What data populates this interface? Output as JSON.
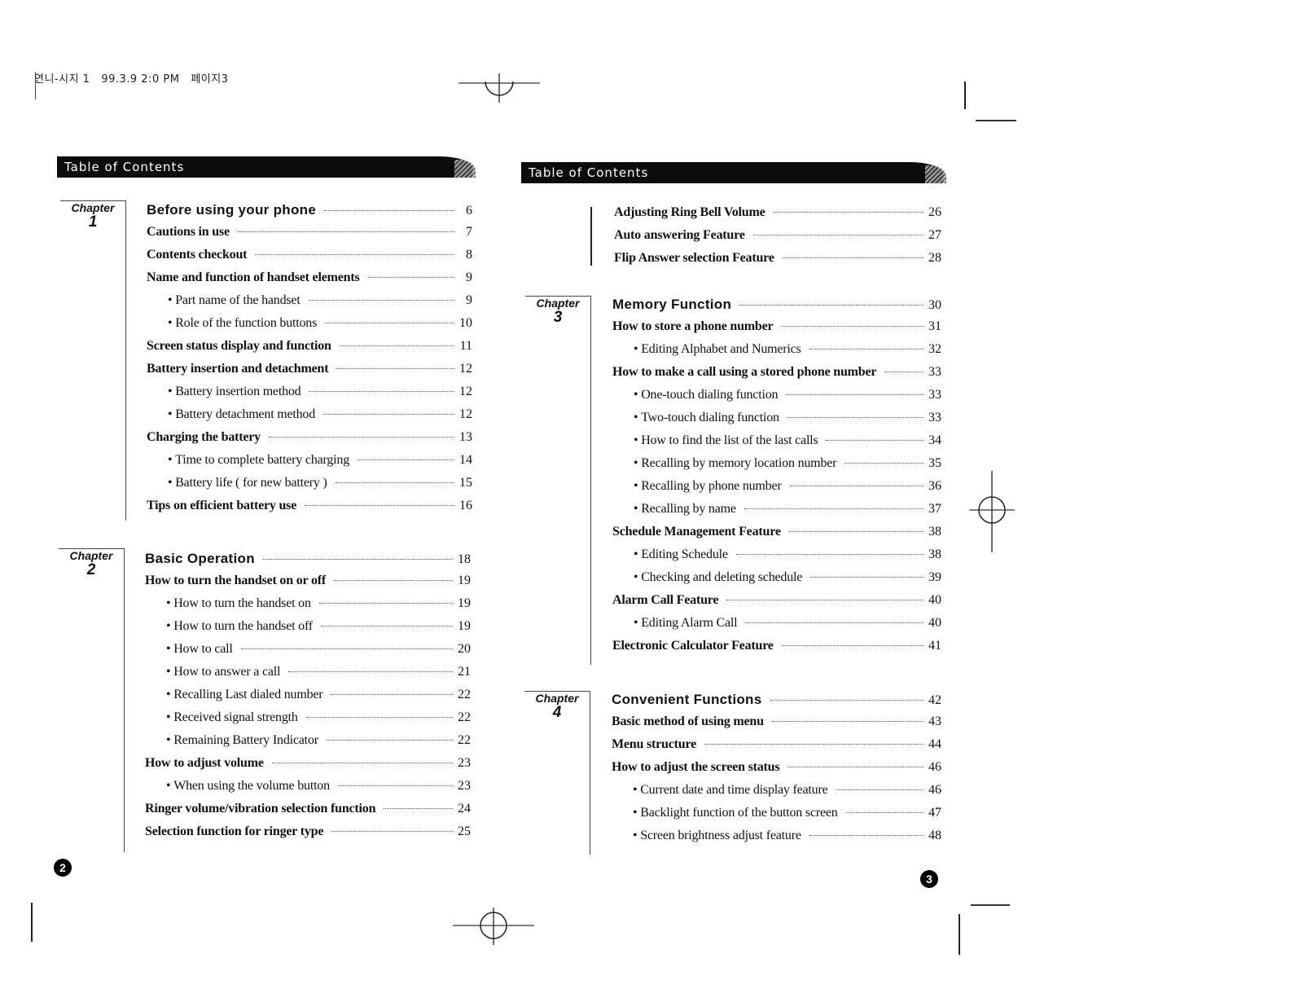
{
  "print_slug": "연니-시지 1   99.3.9 2:0 PM   페이지3",
  "left_page": {
    "header": "Table of Contents",
    "page_number": "2",
    "chapters": [
      {
        "label": "Chapter",
        "number": "1",
        "entries": [
          {
            "level": "chapter",
            "title": "Before using your phone",
            "page": "6"
          },
          {
            "level": "section",
            "title": "Cautions in use",
            "page": "7"
          },
          {
            "level": "section",
            "title": "Contents checkout",
            "page": "8"
          },
          {
            "level": "section",
            "title": "Name and function of handset elements",
            "page": "9"
          },
          {
            "level": "sub",
            "title": "Part name of the handset",
            "page": "9"
          },
          {
            "level": "sub",
            "title": "Role of the function buttons",
            "page": "10"
          },
          {
            "level": "section",
            "title": "Screen status display and function",
            "page": "11"
          },
          {
            "level": "section",
            "title": "Battery insertion and detachment",
            "page": "12"
          },
          {
            "level": "sub",
            "title": "Battery insertion method",
            "page": "12"
          },
          {
            "level": "sub",
            "title": "Battery detachment method",
            "page": "12"
          },
          {
            "level": "section",
            "title": "Charging the battery",
            "page": "13"
          },
          {
            "level": "sub",
            "title": "Time to complete battery charging",
            "page": "14"
          },
          {
            "level": "sub",
            "title": "Battery life ( for new battery )",
            "page": "15"
          },
          {
            "level": "section",
            "title": "Tips on efficient battery use",
            "page": "16"
          }
        ]
      },
      {
        "label": "Chapter",
        "number": "2",
        "entries": [
          {
            "level": "chapter",
            "title": "Basic Operation",
            "page": "18"
          },
          {
            "level": "section",
            "title": "How to turn the handset on or off",
            "page": "19"
          },
          {
            "level": "sub",
            "title": "How to turn the handset on",
            "page": "19"
          },
          {
            "level": "sub",
            "title": "How to turn the handset off",
            "page": "19"
          },
          {
            "level": "sub",
            "title": "How to call",
            "page": "20"
          },
          {
            "level": "sub",
            "title": "How to answer a call",
            "page": "21"
          },
          {
            "level": "sub",
            "title": "Recalling Last dialed number",
            "page": "22"
          },
          {
            "level": "sub",
            "title": "Received signal strength",
            "page": "22"
          },
          {
            "level": "sub",
            "title": "Remaining Battery Indicator",
            "page": "22"
          },
          {
            "level": "section",
            "title": "How to adjust volume",
            "page": "23"
          },
          {
            "level": "sub",
            "title": "When using the volume button",
            "page": "23"
          },
          {
            "level": "section",
            "title": "Ringer volume/vibration selection function",
            "page": "24"
          },
          {
            "level": "section",
            "title": "Selection function for ringer type",
            "page": "25"
          }
        ]
      }
    ]
  },
  "right_page": {
    "header": "Table of Contents",
    "page_number": "3",
    "continued_entries": [
      {
        "level": "section",
        "title": "Adjusting Ring Bell Volume",
        "page": "26"
      },
      {
        "level": "section",
        "title": "Auto answering Feature",
        "page": "27"
      },
      {
        "level": "section",
        "title": "Flip Answer selection Feature",
        "page": "28"
      }
    ],
    "chapters": [
      {
        "label": "Chapter",
        "number": "3",
        "entries": [
          {
            "level": "chapter",
            "title": "Memory Function",
            "page": "30"
          },
          {
            "level": "section",
            "title": "How to store a phone number",
            "page": "31"
          },
          {
            "level": "sub",
            "title": "Editing Alphabet and Numerics",
            "page": "32"
          },
          {
            "level": "section",
            "title": "How to make a call using a stored phone number",
            "page": "33"
          },
          {
            "level": "sub",
            "title": "One-touch dialing function",
            "page": "33"
          },
          {
            "level": "sub",
            "title": "Two-touch dialing function",
            "page": "33"
          },
          {
            "level": "sub",
            "title": "How to find the list of the last calls",
            "page": "34"
          },
          {
            "level": "sub",
            "title": "Recalling by memory location number",
            "page": "35"
          },
          {
            "level": "sub",
            "title": "Recalling by phone number",
            "page": "36"
          },
          {
            "level": "sub",
            "title": "Recalling by name",
            "page": "37"
          },
          {
            "level": "section",
            "title": "Schedule Management Feature",
            "page": "38"
          },
          {
            "level": "sub",
            "title": "Editing Schedule",
            "page": "38"
          },
          {
            "level": "sub",
            "title": "Checking and deleting schedule",
            "page": "39"
          },
          {
            "level": "section",
            "title": "Alarm Call Feature",
            "page": "40"
          },
          {
            "level": "sub",
            "title": "Editing Alarm Call",
            "page": "40"
          },
          {
            "level": "section",
            "title": "Electronic Calculator Feature",
            "page": "41"
          }
        ]
      },
      {
        "label": "Chapter",
        "number": "4",
        "entries": [
          {
            "level": "chapter",
            "title": "Convenient Functions",
            "page": "42"
          },
          {
            "level": "section",
            "title": "Basic method of using menu",
            "page": "43"
          },
          {
            "level": "section",
            "title": "Menu structure",
            "page": "44"
          },
          {
            "level": "section",
            "title": "How to adjust the screen status",
            "page": "46"
          },
          {
            "level": "sub",
            "title": "Current date and time display feature",
            "page": "46"
          },
          {
            "level": "sub",
            "title": "Backlight function of the button screen",
            "page": "47"
          },
          {
            "level": "sub",
            "title": "Screen brightness adjust feature",
            "page": "48"
          }
        ]
      }
    ]
  }
}
